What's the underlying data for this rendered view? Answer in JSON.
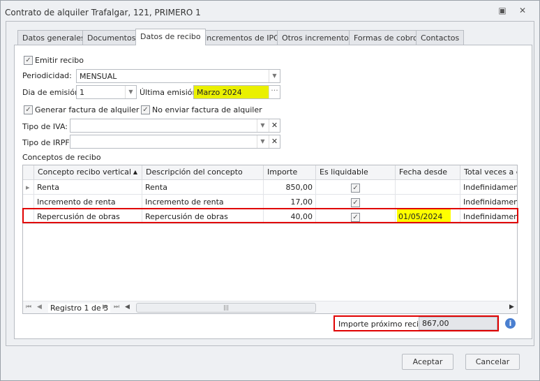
{
  "window": {
    "title": "Contrato de alquiler Trafalgar, 121, PRIMERO 1",
    "restore_icon": "restore-icon",
    "close_icon": "close-icon"
  },
  "tabs": [
    {
      "label": "Datos generales"
    },
    {
      "label": "Documentos"
    },
    {
      "label": "Datos de recibo",
      "active": true
    },
    {
      "label": "Incrementos de IPC"
    },
    {
      "label": "Otros incrementos"
    },
    {
      "label": "Formas de cobro"
    },
    {
      "label": "Contactos"
    }
  ],
  "form": {
    "emitir_recibo": {
      "label": "Emitir recibo",
      "checked": true
    },
    "periodicidad": {
      "label": "Periodicidad:",
      "value": "MENSUAL"
    },
    "dia_emision": {
      "label": "Dia de emisión:",
      "value": "1"
    },
    "ultima_emision": {
      "label": "Última emisión:",
      "value": "Marzo 2024",
      "button": "···"
    },
    "generar_factura": {
      "label": "Generar factura de alquiler",
      "checked": true
    },
    "no_enviar_factura": {
      "label": "No enviar factura de alquiler",
      "checked": true
    },
    "tipo_iva": {
      "label": "Tipo de IVA:",
      "value": ""
    },
    "tipo_irpf": {
      "label": "Tipo de IRPF:",
      "value": ""
    },
    "conceptos_label": "Conceptos de recibo"
  },
  "grid": {
    "columns": [
      "Concepto recibo vertical",
      "Descripción del concepto",
      "Importe",
      "Es liquidable",
      "Fecha desde",
      "Total veces a en"
    ],
    "rows": [
      {
        "concepto": "Renta",
        "descripcion": "Renta",
        "importe": "850,00",
        "liquidable": true,
        "fecha": "",
        "total": "Indefinidamente"
      },
      {
        "concepto": "Incremento de renta",
        "descripcion": "Incremento de renta",
        "importe": "17,00",
        "liquidable": true,
        "fecha": "",
        "total": "Indefinidamente"
      },
      {
        "concepto": "Repercusión de obras",
        "descripcion": "Repercusión de obras",
        "importe": "40,00",
        "liquidable": true,
        "fecha": "01/05/2024",
        "total": "Indefinidamente"
      }
    ],
    "navigator": "Registro 1 de 3"
  },
  "importe_proximo": {
    "label": "Importe próximo recibo",
    "value": "867,00"
  },
  "buttons": {
    "accept": "Aceptar",
    "cancel": "Cancelar"
  },
  "colors": {
    "highlight": "#ffff00",
    "annotation": "#e00000"
  }
}
